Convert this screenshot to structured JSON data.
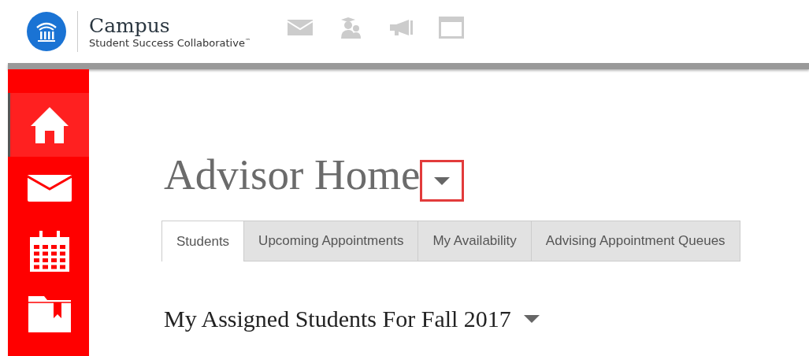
{
  "header": {
    "logo_title": "Campus",
    "logo_subtitle": "Student Success Collaborative$^{™}$",
    "tools": [
      {
        "kind": "mail"
      },
      {
        "kind": "students"
      },
      {
        "kind": "megaphone"
      },
      {
        "kind": "window"
      }
    ]
  },
  "sidebar": {
    "items": [
      {
        "kind": "home",
        "selected": true
      },
      {
        "kind": "mail",
        "selected": false
      },
      {
        "kind": "calendar",
        "selected": false
      },
      {
        "kind": "folder",
        "selected": false
      }
    ]
  },
  "page": {
    "title": "Advisor Home",
    "title_menu_highlighted": true
  },
  "tabs": [
    {
      "label": "Students",
      "selected": true
    },
    {
      "label": "Upcoming Appointments",
      "selected": false
    },
    {
      "label": "My Availability",
      "selected": false
    },
    {
      "label": "Advising Appointment Queues",
      "selected": false
    }
  ],
  "section": {
    "title": "My Assigned Students For Fall 2017"
  }
}
